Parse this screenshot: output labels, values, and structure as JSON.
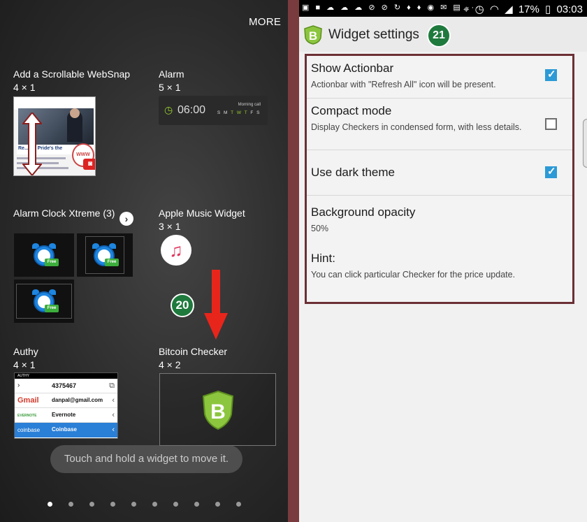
{
  "left": {
    "more_label": "MORE",
    "widgets": [
      {
        "name": "Add a Scrollable WebSnap",
        "size": "4 × 1"
      },
      {
        "name": "Alarm",
        "size": "5 × 1"
      },
      {
        "name": "Alarm Clock Xtreme (3)",
        "size": ""
      },
      {
        "name": "Apple Music Widget",
        "size": "3 × 1"
      },
      {
        "name": "Authy",
        "size": "4 × 1"
      },
      {
        "name": "Bitcoin Checker",
        "size": "4 × 2"
      }
    ],
    "websnap_caption": "Re...up: Pride's the",
    "websnap_www": "WWW",
    "alarm_preview": {
      "time": "06:00",
      "label": "Morning call",
      "days": [
        "S",
        "M",
        "T",
        "W",
        "T",
        "F",
        "S"
      ]
    },
    "free_badge": "Free",
    "authy_preview": {
      "header": "AUTHY",
      "code": "4375467",
      "accounts": [
        {
          "icon": "Gmail",
          "label": "danpal@gmail.com"
        },
        {
          "icon": "EVERNOTE",
          "label": "Evernote"
        },
        {
          "icon": "coinbase",
          "label": "Coinbase"
        }
      ]
    },
    "step_badge": "20",
    "toast": "Touch and hold a widget to move it.",
    "page_dots": 10,
    "active_dot": 0
  },
  "right": {
    "status": {
      "battery": "17%",
      "time": "03:03"
    },
    "title": "Widget settings",
    "step_badge": "21",
    "settings": [
      {
        "title": "Show Actionbar",
        "summary": "Actionbar with \"Refresh All\" icon will be present.",
        "checked": true
      },
      {
        "title": "Compact mode",
        "summary": "Display Checkers in condensed form, with less details.",
        "checked": false
      },
      {
        "title": "Use dark theme",
        "summary": "",
        "checked": true
      },
      {
        "title": "Background opacity",
        "summary": "50%"
      },
      {
        "title": "Hint:",
        "summary": "You can click particular Checker for the price update."
      }
    ]
  },
  "colors": {
    "accent_green": "#1f7a3d",
    "checkbox_blue": "#2b9ad6",
    "frame_border": "#6b2f35",
    "red_arrow": "#e8251b"
  }
}
